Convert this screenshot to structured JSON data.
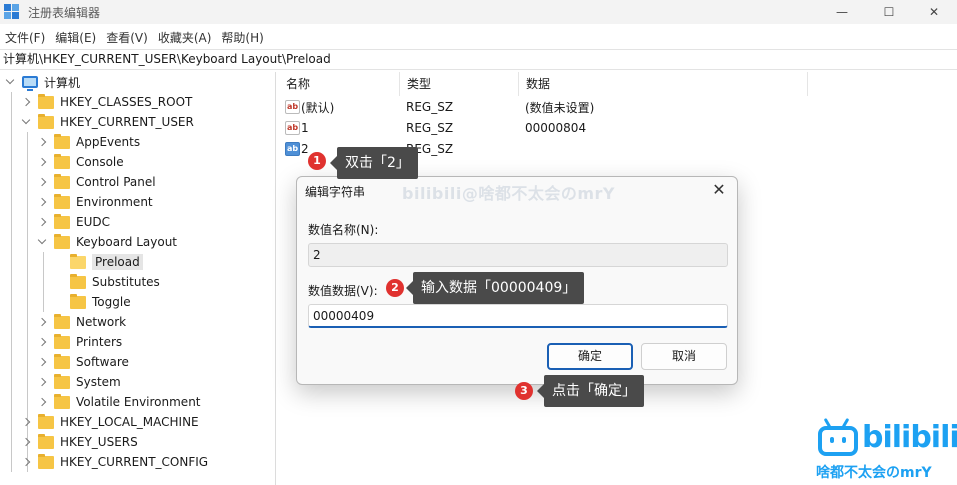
{
  "window": {
    "title": "注册表编辑器",
    "controls": [
      "—",
      "☐",
      "✕"
    ]
  },
  "menu": [
    "文件(F)",
    "编辑(E)",
    "查看(V)",
    "收藏夹(A)",
    "帮助(H)"
  ],
  "address": "计算机\\HKEY_CURRENT_USER\\Keyboard Layout\\Preload",
  "tree": {
    "root": "计算机",
    "items": [
      {
        "label": "HKEY_CLASSES_ROOT"
      },
      {
        "label": "HKEY_CURRENT_USER"
      },
      {
        "label": "AppEvents"
      },
      {
        "label": "Console"
      },
      {
        "label": "Control Panel"
      },
      {
        "label": "Environment"
      },
      {
        "label": "EUDC"
      },
      {
        "label": "Keyboard Layout"
      },
      {
        "label": "Preload"
      },
      {
        "label": "Substitutes"
      },
      {
        "label": "Toggle"
      },
      {
        "label": "Network"
      },
      {
        "label": "Printers"
      },
      {
        "label": "Software"
      },
      {
        "label": "System"
      },
      {
        "label": "Volatile Environment"
      },
      {
        "label": "HKEY_LOCAL_MACHINE"
      },
      {
        "label": "HKEY_USERS"
      },
      {
        "label": "HKEY_CURRENT_CONFIG"
      }
    ]
  },
  "values": {
    "columns": [
      "名称",
      "类型",
      "数据"
    ],
    "rows": [
      {
        "icon": "ab",
        "name": "(默认)",
        "type": "REG_SZ",
        "data": "(数值未设置)"
      },
      {
        "icon": "ab",
        "name": "1",
        "type": "REG_SZ",
        "data": "00000804"
      },
      {
        "icon": "ab",
        "name": "2",
        "type": "REG_SZ",
        "data": ""
      }
    ]
  },
  "dialog": {
    "title": "编辑字符串",
    "name_label": "数值名称(N):",
    "name_value": "2",
    "data_label": "数值数据(V):",
    "data_value": "00000409",
    "ok": "确定",
    "cancel": "取消",
    "close": "✕"
  },
  "watermark": "bilibili@啥都不太会のmrY",
  "annotations": [
    {
      "num": "1",
      "text": "双击「2」"
    },
    {
      "num": "2",
      "text": "输入数据「00000409」"
    },
    {
      "num": "3",
      "text": "点击「确定」"
    }
  ],
  "logo": {
    "word": "bilibili",
    "sub": "啥都不太会のmrY"
  },
  "colors": {
    "accent": "#1a5fb4",
    "badge": "#e0322f",
    "callout": "#4a4a4a",
    "logo": "#1da1f2",
    "folder": "#f6c545"
  }
}
